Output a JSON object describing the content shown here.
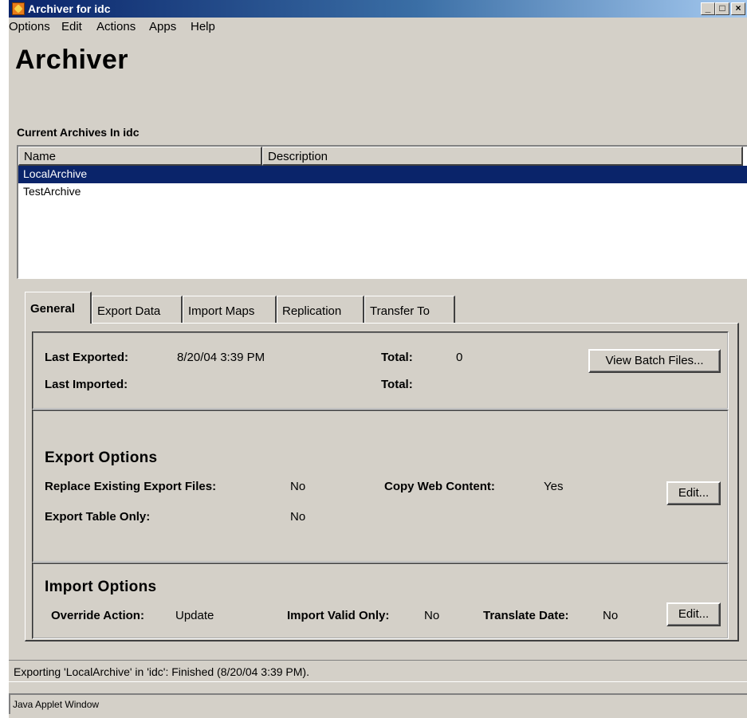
{
  "window": {
    "title": "Archiver for idc",
    "minimize_label": "_",
    "maximize_label": "□",
    "close_label": "×",
    "icon": "archiver-app-icon"
  },
  "menu": {
    "items": [
      "Options",
      "Edit",
      "Actions",
      "Apps",
      "Help"
    ]
  },
  "heading": "Archiver",
  "archives": {
    "section_label": "Current Archives In idc",
    "columns": [
      "Name",
      "Description"
    ],
    "rows": [
      {
        "name": "LocalArchive",
        "description": "",
        "selected": true
      },
      {
        "name": "TestArchive",
        "description": "",
        "selected": false
      }
    ]
  },
  "tabs": [
    {
      "label": "General",
      "active": true
    },
    {
      "label": "Export Data",
      "active": false
    },
    {
      "label": "Import Maps",
      "active": false
    },
    {
      "label": "Replication",
      "active": false
    },
    {
      "label": "Transfer To",
      "active": false
    }
  ],
  "general": {
    "last_exported_label": "Last Exported:",
    "last_exported_value": "8/20/04 3:39 PM",
    "export_total_label": "Total:",
    "export_total_value": "0",
    "last_imported_label": "Last Imported:",
    "import_total_label": "Total:",
    "view_batch_label": "View Batch Files..."
  },
  "export_options": {
    "title": "Export Options",
    "replace_label": "Replace Existing Export Files:",
    "replace_value": "No",
    "copy_web_label": "Copy Web Content:",
    "copy_web_value": "Yes",
    "table_only_label": "Export Table Only:",
    "table_only_value": "No",
    "edit_label": "Edit..."
  },
  "import_options": {
    "title": "Import Options",
    "override_label": "Override Action:",
    "override_value": "Update",
    "valid_only_label": "Import Valid Only:",
    "valid_only_value": "No",
    "translate_label": "Translate Date:",
    "translate_value": "No",
    "edit_label": "Edit..."
  },
  "status": {
    "message": "Exporting 'LocalArchive' in 'idc': Finished (8/20/04 3:39 PM).",
    "applet": "Java Applet Window"
  },
  "colors": {
    "selection": "#0a246a",
    "window_bg": "#d4d0c8"
  }
}
